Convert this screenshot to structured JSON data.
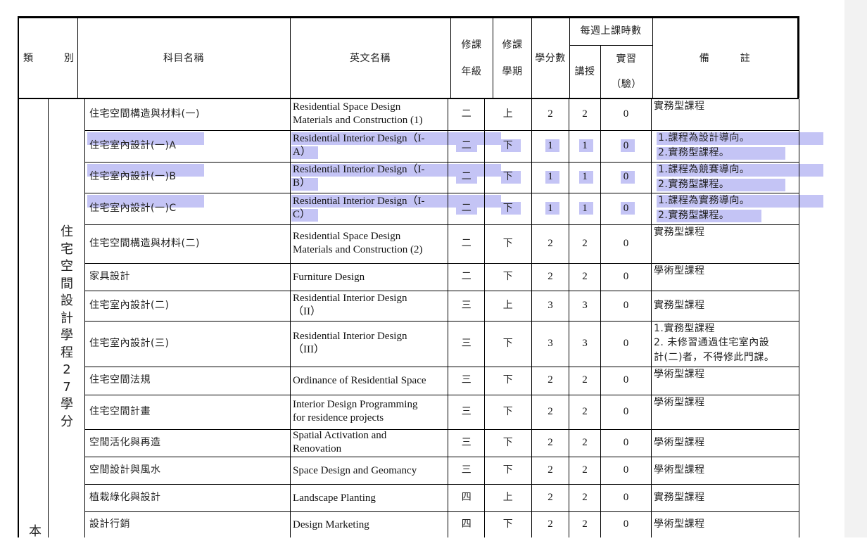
{
  "header": {
    "category": "類　　　別",
    "course_name": "科目名稱",
    "english_name": "英文名稱",
    "grade_l1": "修課",
    "grade_l2": "年級",
    "semester_l1": "修課",
    "semester_l2": "學期",
    "credits": "學分數",
    "weekly_hours": "每週上課時數",
    "lecture": "講授",
    "practice_l1": "實習",
    "practice_l2": "（驗）",
    "remarks": "備　　　註"
  },
  "program_label": "住宅空間設計學程27學分",
  "section_label_partial": "本",
  "rows": [
    {
      "zh": "住宅空間構造與材料(一)",
      "en1": "Residential Space Design",
      "en2": "Materials and Construction (1)",
      "grade": "二",
      "sem": "上",
      "credits": "2",
      "lecture": "2",
      "practice": "0",
      "note1": "實務型課程",
      "note2": "",
      "note3": ""
    },
    {
      "zh": "住宅室內設計(一)A",
      "en1": "Residential Interior Design（I-",
      "en2": "A）",
      "grade": "二",
      "sem": "下",
      "credits": "1",
      "lecture": "1",
      "practice": "0",
      "note1": "1.課程為設計導向。",
      "note2": "2.實務型課程。",
      "note3": ""
    },
    {
      "zh": "住宅室內設計(一)B",
      "en1": "Residential Interior Design（I-",
      "en2": "B）",
      "grade": "二",
      "sem": "下",
      "credits": "1",
      "lecture": "1",
      "practice": "0",
      "note1": "1.課程為競賽導向。",
      "note2": "2.實務型課程。",
      "note3": ""
    },
    {
      "zh": "住宅室內設計(一)C",
      "en1": "Residential Interior Design（I-",
      "en2": "C）",
      "grade": "二",
      "sem": "下",
      "credits": "1",
      "lecture": "1",
      "practice": "0",
      "note1": "1.課程為實務導向。",
      "note2": "2.實務型課程。",
      "note3": ""
    },
    {
      "zh": "住宅空間構造與材料(二)",
      "en1": "Residential Space Design",
      "en2": "Materials and Construction (2)",
      "grade": "二",
      "sem": "下",
      "credits": "2",
      "lecture": "2",
      "practice": "0",
      "note1": "實務型課程",
      "note2": "",
      "note3": ""
    },
    {
      "zh": "家具設計",
      "en1": "Furniture Design",
      "en2": "",
      "grade": "二",
      "sem": "下",
      "credits": "2",
      "lecture": "2",
      "practice": "0",
      "note1": "學術型課程",
      "note2": "",
      "note3": ""
    },
    {
      "zh": "住宅室內設計(二)",
      "en1": "Residential Interior Design",
      "en2": "（II）",
      "grade": "三",
      "sem": "上",
      "credits": "3",
      "lecture": "3",
      "practice": "0",
      "note1": "實務型課程",
      "note2": "",
      "note3": ""
    },
    {
      "zh": "住宅室內設計(三)",
      "en1": "Residential Interior Design",
      "en2": "（III）",
      "grade": "三",
      "sem": "下",
      "credits": "3",
      "lecture": "3",
      "practice": "0",
      "note1": "1.實務型課程",
      "note2": "2. 未修習通過住宅室內設",
      "note3": "計(二)者，不得修此門課。"
    },
    {
      "zh": "住宅空間法規",
      "en1": "Ordinance of Residential Space",
      "en2": "",
      "grade": "三",
      "sem": "下",
      "credits": "2",
      "lecture": "2",
      "practice": "0",
      "note1": "學術型課程",
      "note2": "",
      "note3": ""
    },
    {
      "zh": "住宅空間計畫",
      "en1": "Interior Design Programming",
      "en2": "for residence projects",
      "grade": "三",
      "sem": "下",
      "credits": "2",
      "lecture": "2",
      "practice": "0",
      "note1": "學術型課程",
      "note2": "",
      "note3": ""
    },
    {
      "zh": "空間活化與再造",
      "en1": "Spatial Activation and",
      "en2": "Renovation",
      "grade": "三",
      "sem": "下",
      "credits": "2",
      "lecture": "2",
      "practice": "0",
      "note1": "學術型課程",
      "note2": "",
      "note3": ""
    },
    {
      "zh": "空間設計與風水",
      "en1": "Space Design and Geomancy",
      "en2": "",
      "grade": "三",
      "sem": "下",
      "credits": "2",
      "lecture": "2",
      "practice": "0",
      "note1": "學術型課程",
      "note2": "",
      "note3": ""
    },
    {
      "zh": "植栽綠化與設計",
      "en1": "Landscape Planting",
      "en2": "",
      "grade": "四",
      "sem": "上",
      "credits": "2",
      "lecture": "2",
      "practice": "0",
      "note1": "實務型課程",
      "note2": "",
      "note3": ""
    },
    {
      "zh": "設計行銷",
      "en1": "Design Marketing",
      "en2": "",
      "grade": "四",
      "sem": "下",
      "credits": "2",
      "lecture": "2",
      "practice": "0",
      "note1": "學術型課程",
      "note2": "",
      "note3": ""
    }
  ]
}
